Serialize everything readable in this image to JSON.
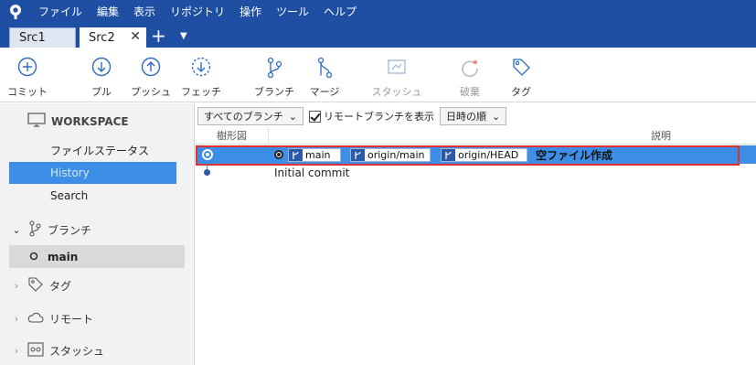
{
  "menu": {
    "items": [
      "ファイル",
      "編集",
      "表示",
      "リポジトリ",
      "操作",
      "ツール",
      "ヘルプ"
    ]
  },
  "tabs": [
    {
      "label": "Src1",
      "active": false
    },
    {
      "label": "Src2",
      "active": true
    }
  ],
  "toolbar": {
    "commit": "コミット",
    "pull": "プル",
    "push": "プッシュ",
    "fetch": "フェッチ",
    "branch": "ブランチ",
    "merge": "マージ",
    "stash": "スタッシュ",
    "discard": "破棄",
    "tag": "タグ"
  },
  "sidebar": {
    "workspace_title": "WORKSPACE",
    "items": [
      "ファイルステータス",
      "History",
      "Search"
    ],
    "selected": "History",
    "branches_label": "ブランチ",
    "branch_main": "main",
    "tags_label": "タグ",
    "remote_label": "リモート",
    "stash_label": "スタッシュ"
  },
  "filters": {
    "branches_dropdown": "すべてのブランチ",
    "show_remote": "リモートブランチを表示",
    "order_dropdown": "日時の順"
  },
  "columns": {
    "graph": "樹形図",
    "description": "説明"
  },
  "commits": [
    {
      "refs": [
        "main",
        "origin/main",
        "origin/HEAD"
      ],
      "message": "空ファイル作成"
    },
    {
      "refs": [],
      "message": "Initial commit"
    }
  ],
  "colors": {
    "titlebar": "#1f4fa3",
    "selection": "#3c8ee6",
    "highlight_border": "#e03030",
    "icon_blue": "#2d6bc4"
  }
}
